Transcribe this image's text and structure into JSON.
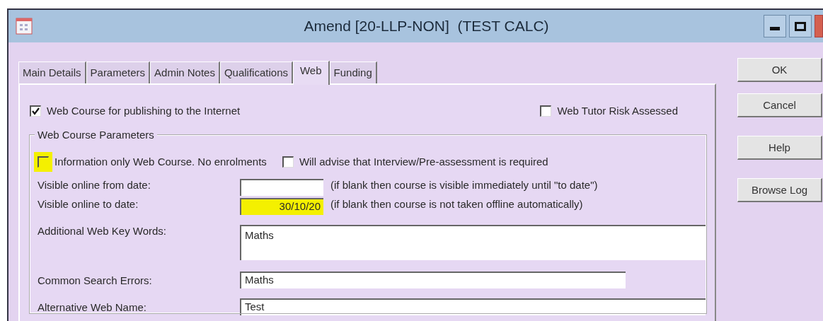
{
  "window": {
    "title": "Amend [20-LLP-NON]  (TEST CALC)"
  },
  "tabs": [
    {
      "label": "Main Details",
      "selected": false
    },
    {
      "label": "Parameters",
      "selected": false
    },
    {
      "label": "Admin Notes",
      "selected": false
    },
    {
      "label": "Qualifications",
      "selected": false
    },
    {
      "label": "Web",
      "selected": true
    },
    {
      "label": "Funding",
      "selected": false
    }
  ],
  "web_course": {
    "label": "Web Course for publishing to the Internet",
    "checked": true
  },
  "tutor_risk": {
    "label": "Web Tutor Risk Assessed",
    "checked": false
  },
  "parameters": {
    "title": "Web Course Parameters",
    "options": [
      {
        "label": "Information only Web Course. No enrolments",
        "checked": false,
        "highlighted": true
      },
      {
        "label": "Will advise that Interview/Pre-assessment is required",
        "checked": false,
        "highlighted": false
      }
    ],
    "fields": [
      {
        "kind": "date",
        "label": "Visible online from date:",
        "note": "(if blank then course is visible immediately until \"to date\")",
        "highlighted": false
      },
      {
        "kind": "date",
        "label": "Visible online to date:",
        "value": "30/10/20",
        "note": "(if blank then course is not taken offline automatically)",
        "highlighted": true
      },
      {
        "kind": "multiline",
        "label": "Additional Web Key Words:",
        "value": "Maths"
      },
      {
        "kind": "short",
        "label": "Common Search Errors:",
        "value": "Maths"
      },
      {
        "kind": "long",
        "label": "Alternative Web Name:",
        "value": "Test"
      }
    ]
  },
  "buttons": [
    "OK",
    "Cancel",
    "Help",
    "Browse Log"
  ]
}
